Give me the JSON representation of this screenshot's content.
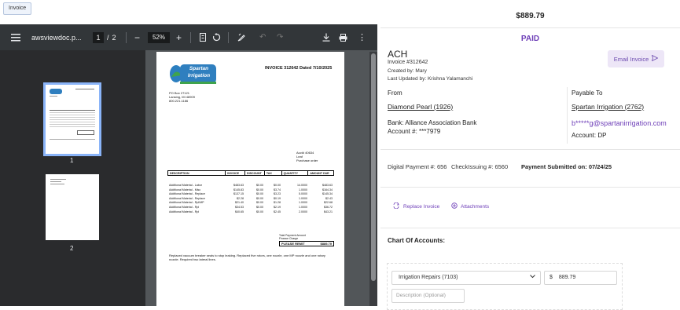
{
  "tabs": [
    {
      "label": "Invoice"
    }
  ],
  "viewer": {
    "filename": "awsviewdoc.p...",
    "page_current": "1",
    "page_sep": "/",
    "page_total": "2",
    "zoom": "52%",
    "thumb_labels": [
      "1",
      "2"
    ]
  },
  "pdf": {
    "logo_text": "Spartan Irrigation",
    "invoice_title": "INVOICE 312642 Dated 7/10/2025",
    "address": [
      "PO Box 27121",
      "Lansing, MI 48909",
      "800.221.1186"
    ],
    "ship": [
      "Acct# 40634",
      "Leaf",
      "Purchase order"
    ],
    "headers": [
      "DESCRIPTION",
      "INVOICE",
      "DISCOUNT",
      "TAX",
      "QUANTITY",
      "AMOUNT DUE"
    ],
    "rows": [
      [
        "Additional Material - Labor",
        "$483.63",
        "$0.00",
        "$0.00",
        "14.0000",
        "$483.63"
      ],
      [
        "Additional Material - Misc",
        "$145.83",
        "$0.00",
        "$3.74",
        "1.0000",
        "$164.34"
      ],
      [
        "Additional Material - Replace",
        "$137.15",
        "$0.00",
        "$3.23",
        "5.0000",
        "$145.34"
      ],
      [
        "Additional Material - Replace",
        "$2.28",
        "$0.00",
        "$0.19",
        "1.0000",
        "$2.43"
      ],
      [
        "Additional Material - Rpl/MP",
        "$21.40",
        "$0.00",
        "$1.28",
        "1.0000",
        "$22.68"
      ],
      [
        "Additional Material - Rpl",
        "$34.53",
        "$0.00",
        "$2.19",
        "1.0000",
        "$36.72"
      ],
      [
        "Additional Material - Rpl",
        "$40.65",
        "$0.00",
        "$2.45",
        "2.0000",
        "$43.21"
      ]
    ],
    "totals": [
      "Total Payment Amount",
      "Finance Charge",
      "PLEASE REMIT",
      "$889.79"
    ],
    "note": "Replaced vacuum breaker seals to stop leaking. Replaced five rotors, one nozzle, one MP nozzle and one rotary nozzle. Required two lateral lines."
  },
  "invoice": {
    "total": "$889.79",
    "status": "PAID",
    "method": "ACH",
    "number": "Invoice #312642",
    "created_by": "Created by: Mary",
    "updated_by": "Last Updated by: Krishna Yalamanchi",
    "email_button": "Email Invoice",
    "from_label": "From",
    "from_name": "Diamond Pearl (1926)",
    "bank": "Bank: Alliance Association Bank",
    "account": "Account #: ***7979",
    "payable_label": "Payable To",
    "payable_name": "Spartan Irrigation (2762)",
    "payable_email": "b*****g@spartanirrigation.com",
    "payable_account": "Account: DP",
    "digital_payment": "Digital Payment #: 656",
    "check_issuing": "CheckIssuing #: 6560",
    "submitted": "Payment Submitted on: 07/24/25",
    "replace_invoice": "Replace Invoice",
    "attachments": "Attachments",
    "chart_title": "Chart Of Accounts:",
    "account_select": "Irrigation Repairs (7103)",
    "amount_prefix": "$",
    "amount_value": "889.79",
    "description_placeholder": "Description (Optional)"
  },
  "colors": {
    "accent": "#6e3fb8",
    "toolbar": "#323639",
    "sidebar": "#2a2b2d",
    "viewer_bg": "#525659",
    "thumb_highlight": "#8ab4f8"
  }
}
